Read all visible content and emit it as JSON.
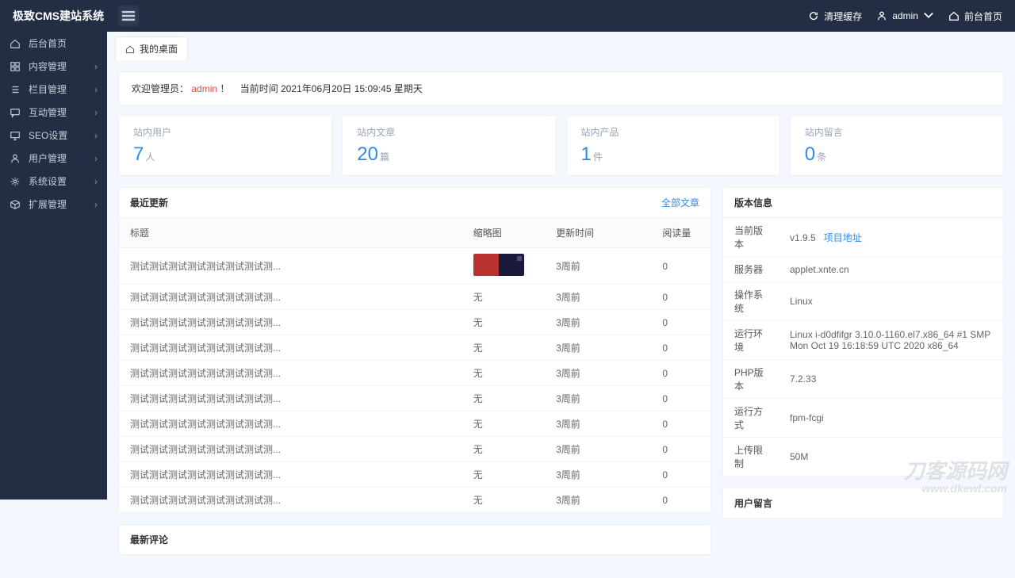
{
  "brand": "极致CMS建站系统",
  "topbar": {
    "clear_cache": "清理缓存",
    "user": "admin",
    "front": "前台首页"
  },
  "sidebar": {
    "items": [
      {
        "label": "后台首页",
        "icon": "home",
        "arrow": false
      },
      {
        "label": "内容管理",
        "icon": "grid",
        "arrow": true
      },
      {
        "label": "栏目管理",
        "icon": "list",
        "arrow": true
      },
      {
        "label": "互动管理",
        "icon": "chat",
        "arrow": true
      },
      {
        "label": "SEO设置",
        "icon": "monitor",
        "arrow": true
      },
      {
        "label": "用户管理",
        "icon": "user",
        "arrow": true
      },
      {
        "label": "系统设置",
        "icon": "gear",
        "arrow": true
      },
      {
        "label": "扩展管理",
        "icon": "cube",
        "arrow": true
      }
    ]
  },
  "tab": {
    "label": "我的桌面"
  },
  "welcome": {
    "prefix": "欢迎管理员：",
    "name": "admin",
    "suffix": "！",
    "time_label": "当前时间 2021年06月20日 15:09:45 星期天"
  },
  "stats": [
    {
      "label": "站内用户",
      "value": "7",
      "unit": "人"
    },
    {
      "label": "站内文章",
      "value": "20",
      "unit": "篇"
    },
    {
      "label": "站内产品",
      "value": "1",
      "unit": "件"
    },
    {
      "label": "站内留言",
      "value": "0",
      "unit": "条"
    }
  ],
  "recent": {
    "title": "最近更新",
    "all_link": "全部文章",
    "cols": {
      "title": "标题",
      "thumb": "缩略图",
      "time": "更新时间",
      "reads": "阅读量"
    },
    "rows": [
      {
        "title": "测试测试测试测试测试测试测试测...",
        "thumb": true,
        "time": "3周前",
        "reads": "0"
      },
      {
        "title": "测试测试测试测试测试测试测试测...",
        "thumb": false,
        "time": "3周前",
        "reads": "0"
      },
      {
        "title": "测试测试测试测试测试测试测试测...",
        "thumb": false,
        "time": "3周前",
        "reads": "0"
      },
      {
        "title": "测试测试测试测试测试测试测试测...",
        "thumb": false,
        "time": "3周前",
        "reads": "0"
      },
      {
        "title": "测试测试测试测试测试测试测试测...",
        "thumb": false,
        "time": "3周前",
        "reads": "0"
      },
      {
        "title": "测试测试测试测试测试测试测试测...",
        "thumb": false,
        "time": "3周前",
        "reads": "0"
      },
      {
        "title": "测试测试测试测试测试测试测试测...",
        "thumb": false,
        "time": "3周前",
        "reads": "0"
      },
      {
        "title": "测试测试测试测试测试测试测试测...",
        "thumb": false,
        "time": "3周前",
        "reads": "0"
      },
      {
        "title": "测试测试测试测试测试测试测试测...",
        "thumb": false,
        "time": "3周前",
        "reads": "0"
      },
      {
        "title": "测试测试测试测试测试测试测试测...",
        "thumb": false,
        "time": "3周前",
        "reads": "0"
      }
    ],
    "no_thumb": "无"
  },
  "comments": {
    "title": "最新评论"
  },
  "version": {
    "title": "版本信息",
    "rows": [
      {
        "k": "当前版本",
        "v": "v1.9.5",
        "link": "项目地址"
      },
      {
        "k": "服务器",
        "v": "applet.xnte.cn"
      },
      {
        "k": "操作系统",
        "v": "Linux"
      },
      {
        "k": "运行环境",
        "v": "Linux i-d0dfifgr 3.10.0-1160.el7.x86_64 #1 SMP Mon Oct 19 16:18:59 UTC 2020 x86_64"
      },
      {
        "k": "PHP版本",
        "v": "7.2.33"
      },
      {
        "k": "运行方式",
        "v": "fpm-fcgi"
      },
      {
        "k": "上传限制",
        "v": "50M"
      }
    ]
  },
  "guestbook": {
    "title": "用户留言"
  },
  "watermark": {
    "line1": "刀客源码网",
    "line2": "www.dkewl.com"
  }
}
